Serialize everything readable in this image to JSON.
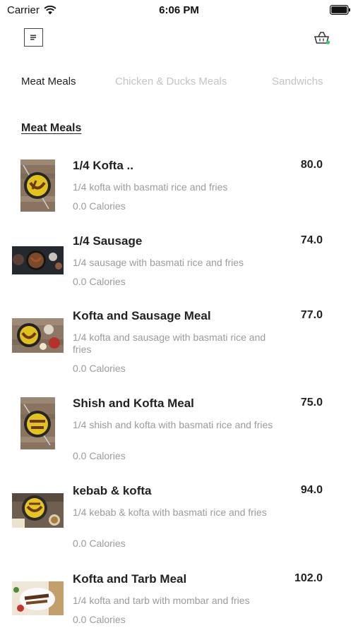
{
  "status": {
    "carrier": "Carrier",
    "time": "6:06 PM"
  },
  "icons": {
    "menu": "menu-icon",
    "cart": "shopping-basket-icon",
    "wifi": "wifi-icon",
    "battery": "battery-icon"
  },
  "colors": {
    "accent": "#2ecc71",
    "muted": "#9b9b9b",
    "inactive_tab": "#c4c4c4",
    "text": "#222222"
  },
  "tabs": [
    {
      "label": "Meat Meals",
      "active": true
    },
    {
      "label": "Chicken & Ducks Meals",
      "active": false
    },
    {
      "label": "Sandwichs",
      "active": false
    }
  ],
  "section": {
    "title": "Meat Meals"
  },
  "items": [
    {
      "name": "1/4 Kofta ..",
      "price": "80.0",
      "desc": "1/4 kofta with basmati rice and fries",
      "calories": "0.0 Calories"
    },
    {
      "name": "1/4 Sausage",
      "price": "74.0",
      "desc": "1/4 sausage with basmati rice and fries",
      "calories": "0.0 Calories"
    },
    {
      "name": "Kofta and Sausage Meal",
      "price": "77.0",
      "desc": "1/4 kofta and sausage with basmati rice and fries",
      "calories": "0.0 Calories"
    },
    {
      "name": "Shish and Kofta Meal",
      "price": "75.0",
      "desc": "1/4 shish and kofta with basmati rice and fries",
      "calories": "0.0 Calories"
    },
    {
      "name": "kebab & kofta",
      "price": "94.0",
      "desc": "1/4 kebab & kofta with basmati rice and fries",
      "calories": "0.0 Calories"
    },
    {
      "name": "Kofta and Tarb Meal",
      "price": "102.0",
      "desc": "1/4 kofta and tarb with mombar and fries",
      "calories": "0.0 Calories"
    }
  ]
}
